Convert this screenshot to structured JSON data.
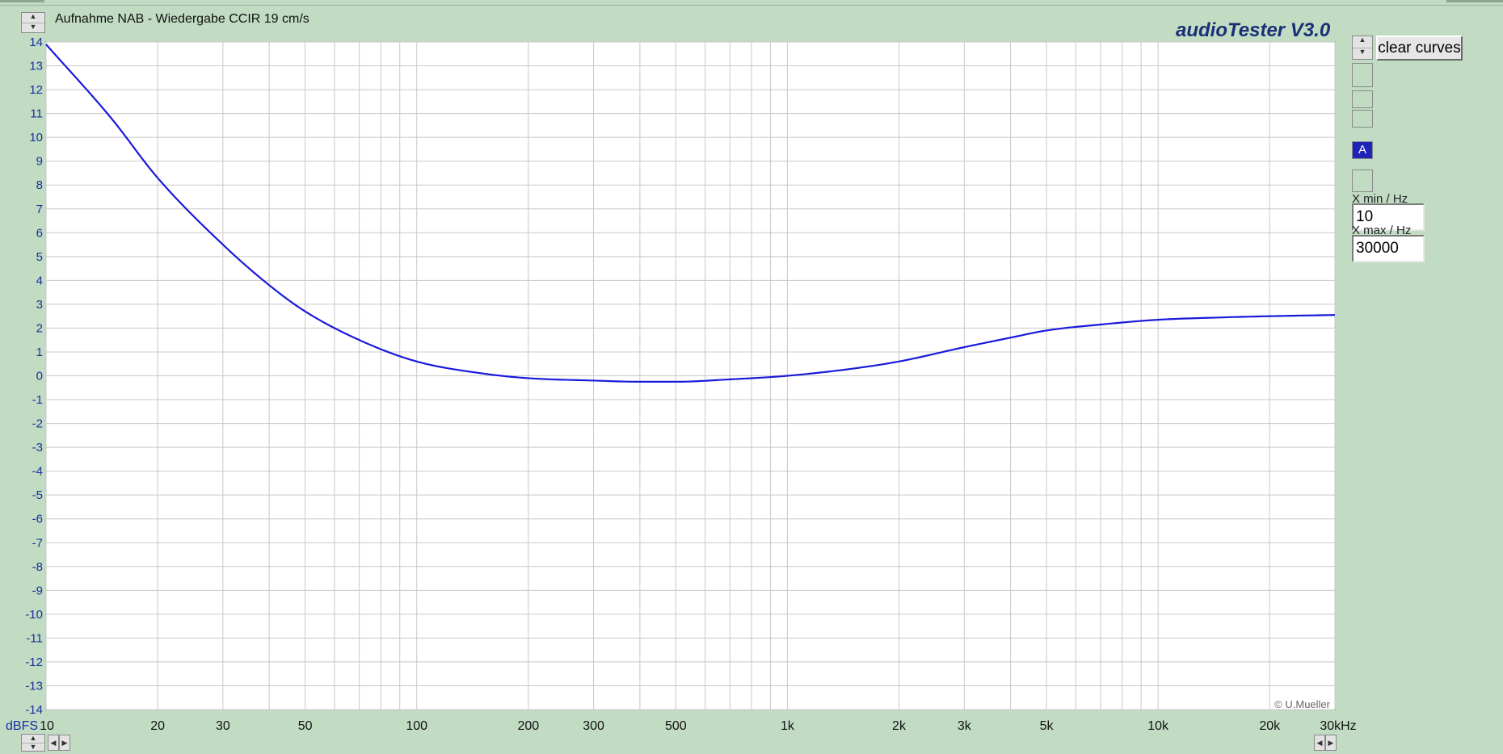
{
  "window": {
    "title": "Aufnahme NAB - Wiedergabe CCIR 19 cm/s",
    "brand": "audioTester  V3.0",
    "copyright": "© U.Mueller"
  },
  "controls": {
    "clear_curves": "clear curves",
    "channel_slots": [
      "",
      "",
      "",
      "A",
      ""
    ],
    "active_slot": "A",
    "xmin_label": "X min / Hz",
    "xmin_value": "10",
    "xmax_label": "X max / Hz",
    "xmax_value": "30000"
  },
  "colors": {
    "background": "#c1dcc3",
    "plot_bg": "#ffffff",
    "grid": "#c8c8c8",
    "axis_text": "#1a2fa0",
    "curve": "#1a1adb",
    "brand": "#1a2f75"
  },
  "icons": {
    "spin": "up-down-arrows-icon",
    "scroll_left": "arrow-left-icon",
    "scroll_right": "arrow-right-icon"
  },
  "chart_data": {
    "type": "line",
    "title": "Aufnahme NAB - Wiedergabe CCIR 19 cm/s",
    "xlabel": "kHz",
    "ylabel": "dBFS",
    "x_scale": "log",
    "xlim": [
      10,
      30000
    ],
    "ylim": [
      -14,
      14
    ],
    "grid": true,
    "x_ticks": [
      10,
      20,
      30,
      50,
      100,
      200,
      300,
      500,
      1000,
      2000,
      3000,
      5000,
      10000,
      20000,
      30000
    ],
    "x_tick_labels": [
      "10",
      "20",
      "30",
      "50",
      "100",
      "200",
      "300",
      "500",
      "1k",
      "2k",
      "3k",
      "5k",
      "10k",
      "20k",
      "30kHz"
    ],
    "y_ticks": [
      14,
      13,
      12,
      11,
      10,
      9,
      8,
      7,
      6,
      5,
      4,
      3,
      2,
      1,
      0,
      -1,
      -2,
      -3,
      -4,
      -5,
      -6,
      -7,
      -8,
      -9,
      -10,
      -11,
      -12,
      -13,
      -14
    ],
    "y_axis_unit_label": "dBFS",
    "series": [
      {
        "x": [
          10,
          15,
          20,
          30,
          40,
          50,
          70,
          100,
          150,
          200,
          300,
          400,
          500,
          700,
          1000,
          1500,
          2000,
          3000,
          4000,
          5000,
          7000,
          10000,
          15000,
          20000,
          30000
        ],
        "y": [
          13.9,
          10.8,
          8.3,
          5.5,
          3.8,
          2.7,
          1.5,
          0.6,
          0.1,
          -0.1,
          -0.2,
          -0.25,
          -0.25,
          -0.15,
          0.0,
          0.3,
          0.6,
          1.2,
          1.6,
          1.9,
          2.15,
          2.35,
          2.45,
          2.5,
          2.55
        ]
      }
    ]
  }
}
